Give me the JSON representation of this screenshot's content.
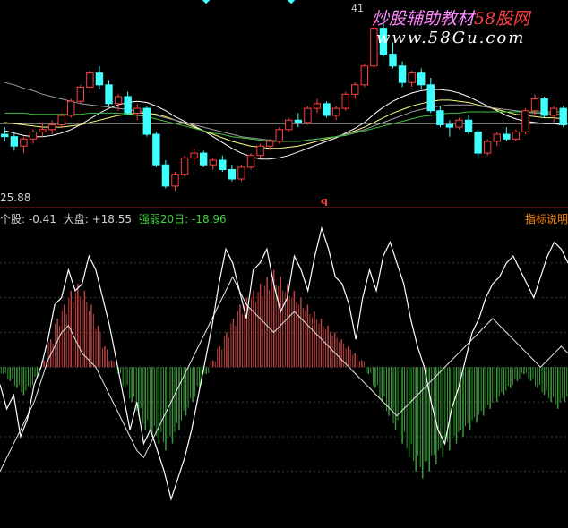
{
  "price_panel": {
    "low_label": "25.88",
    "high_label": "41",
    "marker_label": "q"
  },
  "indicator_header": {
    "stock_text": "个股: -0.41",
    "market_text": "大盘: +18.55",
    "strength_text": "强弱20日: -18.96",
    "help_button": "指标说明"
  },
  "watermark": {
    "cn_part1": "炒股辅助教材",
    "cn_part2": "58股网",
    "url": "www.58Gu.com"
  },
  "colors": {
    "up": "#ff4040",
    "down": "#40ffff",
    "hist_up": "#c04040",
    "hist_down": "#3a9a3a",
    "line_white": "#ffffff",
    "stock_green": "#40d040",
    "watermark": "#ff88ff"
  },
  "chart_data": [
    {
      "type": "candlestick",
      "title": "",
      "ylim": [
        25.5,
        42
      ],
      "ohlc": [
        [
          31.2,
          31.8,
          30.6,
          31.0
        ],
        [
          31.0,
          31.4,
          29.8,
          30.2
        ],
        [
          30.2,
          31.0,
          29.6,
          30.8
        ],
        [
          30.8,
          31.6,
          30.4,
          31.4
        ],
        [
          31.4,
          32.2,
          31.0,
          31.6
        ],
        [
          31.6,
          32.4,
          31.2,
          32.0
        ],
        [
          32.0,
          33.0,
          31.8,
          32.8
        ],
        [
          32.8,
          34.2,
          32.6,
          34.0
        ],
        [
          34.0,
          35.4,
          33.8,
          35.2
        ],
        [
          35.2,
          36.6,
          34.8,
          36.4
        ],
        [
          36.4,
          37.0,
          35.0,
          35.4
        ],
        [
          35.4,
          35.8,
          33.6,
          33.8
        ],
        [
          33.8,
          34.6,
          33.2,
          34.4
        ],
        [
          34.4,
          34.8,
          32.8,
          33.0
        ],
        [
          33.0,
          33.8,
          32.4,
          33.4
        ],
        [
          33.4,
          33.6,
          31.0,
          31.2
        ],
        [
          31.2,
          31.4,
          28.4,
          28.6
        ],
        [
          28.6,
          29.0,
          26.6,
          26.8
        ],
        [
          26.8,
          28.0,
          26.4,
          27.8
        ],
        [
          27.8,
          29.4,
          27.6,
          29.2
        ],
        [
          29.2,
          30.0,
          28.6,
          29.6
        ],
        [
          29.6,
          29.8,
          28.4,
          28.6
        ],
        [
          28.6,
          29.2,
          28.2,
          29.0
        ],
        [
          29.0,
          29.4,
          28.0,
          28.2
        ],
        [
          28.2,
          28.6,
          27.2,
          27.4
        ],
        [
          27.4,
          28.6,
          27.2,
          28.4
        ],
        [
          28.4,
          29.6,
          28.2,
          29.4
        ],
        [
          29.4,
          30.4,
          29.2,
          30.2
        ],
        [
          30.2,
          30.8,
          29.8,
          30.6
        ],
        [
          30.6,
          31.8,
          30.4,
          31.6
        ],
        [
          31.6,
          32.6,
          31.4,
          32.4
        ],
        [
          32.4,
          33.0,
          31.8,
          32.2
        ],
        [
          32.2,
          33.6,
          32.0,
          33.4
        ],
        [
          33.4,
          34.2,
          33.0,
          33.8
        ],
        [
          33.8,
          34.0,
          32.6,
          32.8
        ],
        [
          32.8,
          33.6,
          32.4,
          33.4
        ],
        [
          33.4,
          34.8,
          33.2,
          34.6
        ],
        [
          34.6,
          35.6,
          34.2,
          35.4
        ],
        [
          35.4,
          37.2,
          35.2,
          37.0
        ],
        [
          37.0,
          41.0,
          36.8,
          40.2
        ],
        [
          40.2,
          40.6,
          37.8,
          38.0
        ],
        [
          38.0,
          39.0,
          36.8,
          37.0
        ],
        [
          37.0,
          37.4,
          35.2,
          35.6
        ],
        [
          35.6,
          36.6,
          35.2,
          36.4
        ],
        [
          36.4,
          36.8,
          35.0,
          35.4
        ],
        [
          35.4,
          36.0,
          33.0,
          33.2
        ],
        [
          33.2,
          33.6,
          31.8,
          32.0
        ],
        [
          32.0,
          32.4,
          31.0,
          31.8
        ],
        [
          31.8,
          32.6,
          31.6,
          32.4
        ],
        [
          32.4,
          32.8,
          31.2,
          31.4
        ],
        [
          31.4,
          31.6,
          29.2,
          29.6
        ],
        [
          29.6,
          30.8,
          29.4,
          30.6
        ],
        [
          30.6,
          31.4,
          30.2,
          31.2
        ],
        [
          31.2,
          31.8,
          30.6,
          30.8
        ],
        [
          30.8,
          31.6,
          30.6,
          31.4
        ],
        [
          31.4,
          33.4,
          31.2,
          33.2
        ],
        [
          33.2,
          34.6,
          32.8,
          34.2
        ],
        [
          34.2,
          34.4,
          32.6,
          32.8
        ],
        [
          32.8,
          33.6,
          32.2,
          33.4
        ],
        [
          33.4,
          33.6,
          31.8,
          32.0
        ]
      ],
      "moving_averages": [
        {
          "values": [
            31.5,
            31.3,
            31.1,
            31.0,
            31.0,
            31.1,
            31.3,
            31.6,
            32.0,
            32.5,
            33.0,
            33.4,
            33.7,
            33.9,
            34.0,
            33.9,
            33.6,
            33.2,
            32.7,
            32.3,
            31.9,
            31.5,
            31.0,
            30.5,
            30.0,
            29.6,
            29.3,
            29.1,
            29.1,
            29.2,
            29.4,
            29.7,
            30.0,
            30.3,
            30.6,
            30.9,
            31.3,
            31.7,
            32.2,
            32.9,
            33.5,
            34.0,
            34.4,
            34.7,
            34.9,
            35.0,
            35.0,
            34.9,
            34.7,
            34.4,
            34.0,
            33.6,
            33.2,
            32.8,
            32.5,
            32.3,
            32.2,
            32.1,
            32.1,
            32.0
          ]
        },
        {
          "values": [
            32.2,
            32.1,
            32.0,
            31.9,
            31.8,
            31.8,
            31.8,
            31.9,
            32.0,
            32.2,
            32.4,
            32.6,
            32.8,
            32.9,
            33.0,
            33.0,
            32.9,
            32.7,
            32.4,
            32.1,
            31.8,
            31.5,
            31.2,
            30.9,
            30.6,
            30.4,
            30.2,
            30.1,
            30.0,
            30.0,
            30.1,
            30.2,
            30.4,
            30.6,
            30.8,
            31.0,
            31.2,
            31.5,
            31.8,
            32.2,
            32.6,
            33.0,
            33.3,
            33.6,
            33.8,
            34.0,
            34.1,
            34.1,
            34.0,
            33.9,
            33.7,
            33.5,
            33.3,
            33.1,
            32.9,
            32.8,
            32.7,
            32.6,
            32.6,
            32.5
          ]
        },
        {
          "values": [
            35.6,
            35.4,
            35.1,
            34.9,
            34.6,
            34.4,
            34.2,
            34.0,
            33.8,
            33.7,
            33.6,
            33.5,
            33.4,
            33.3,
            33.2,
            33.0,
            32.8,
            32.6,
            32.4,
            32.2,
            32.0,
            31.8,
            31.6,
            31.4,
            31.2,
            31.0,
            30.9,
            30.8,
            30.7,
            30.6,
            30.6,
            30.6,
            30.7,
            30.8,
            30.9,
            31.0,
            31.2,
            31.4,
            31.6,
            31.9,
            32.2,
            32.5,
            32.8,
            33.1,
            33.3,
            33.5,
            33.6,
            33.7,
            33.7,
            33.7,
            33.6,
            33.5,
            33.4,
            33.3,
            33.2,
            33.1,
            33.0,
            33.0,
            32.9,
            32.9
          ]
        },
        {
          "values": [
            33.0,
            33.0,
            33.0,
            32.9,
            32.9,
            32.9,
            32.9,
            32.9,
            32.9,
            33.0,
            33.0,
            33.0,
            33.0,
            32.9,
            32.8,
            32.7,
            32.5,
            32.3,
            32.1,
            31.9,
            31.7,
            31.5,
            31.3,
            31.2,
            31.0,
            30.9,
            30.8,
            30.7,
            30.6,
            30.6,
            30.6,
            30.6,
            30.7,
            30.8,
            30.9,
            31.0,
            31.1,
            31.3,
            31.5,
            31.7,
            31.9,
            32.1,
            32.3,
            32.5,
            32.7,
            32.8,
            32.9,
            33.0,
            33.0,
            33.1,
            33.1,
            33.1,
            33.1,
            33.1,
            33.1,
            33.1,
            33.1,
            33.1,
            33.1,
            33.1
          ]
        }
      ]
    },
    {
      "type": "line",
      "title": "",
      "ylim": [
        -45,
        40
      ],
      "series": [
        {
          "name": "个股",
          "values": [
            -5,
            -12,
            -8,
            -20,
            -15,
            -5,
            0,
            8,
            18,
            20,
            28,
            22,
            24,
            32,
            28,
            20,
            12,
            2,
            -8,
            -18,
            -10,
            -22,
            -18,
            -24,
            -30,
            -38,
            -32,
            -26,
            -18,
            -8,
            2,
            12,
            24,
            34,
            30,
            22,
            14,
            28,
            30,
            34,
            24,
            16,
            20,
            32,
            28,
            22,
            32,
            40,
            34,
            26,
            24,
            18,
            8,
            20,
            28,
            22,
            32,
            36,
            30,
            24,
            14,
            6,
            0,
            -10,
            -18,
            -22,
            -12,
            -6,
            2,
            10,
            14,
            20,
            24,
            26,
            30,
            32,
            28,
            24,
            20,
            26,
            32,
            36,
            34,
            30
          ]
        },
        {
          "name": "大盘",
          "values": [
            -30,
            -26,
            -22,
            -18,
            -14,
            -10,
            -4,
            2,
            6,
            10,
            12,
            8,
            4,
            2,
            0,
            -4,
            -8,
            -12,
            -16,
            -20,
            -24,
            -26,
            -22,
            -18,
            -14,
            -10,
            -6,
            -2,
            2,
            6,
            10,
            14,
            18,
            22,
            26,
            22,
            18,
            16,
            14,
            12,
            10,
            12,
            14,
            16,
            14,
            12,
            10,
            8,
            6,
            4,
            2,
            0,
            -2,
            -4,
            -6,
            -8,
            -10,
            -12,
            -14,
            -12,
            -10,
            -8,
            -6,
            -4,
            -2,
            0,
            2,
            4,
            6,
            8,
            10,
            12,
            14,
            12,
            10,
            8,
            6,
            4,
            2,
            0,
            2,
            4,
            6,
            4
          ]
        },
        {
          "name": "强弱20日",
          "values": [
            -2,
            -4,
            -6,
            -8,
            -6,
            -3,
            2,
            8,
            14,
            18,
            22,
            24,
            22,
            18,
            12,
            6,
            2,
            -2,
            -6,
            -10,
            -14,
            -18,
            -20,
            -22,
            -24,
            -22,
            -18,
            -14,
            -10,
            -6,
            -2,
            2,
            6,
            10,
            14,
            18,
            20,
            22,
            24,
            26,
            28,
            26,
            24,
            22,
            20,
            18,
            16,
            14,
            12,
            10,
            8,
            6,
            4,
            2,
            -2,
            -6,
            -10,
            -14,
            -18,
            -22,
            -26,
            -30,
            -32,
            -30,
            -28,
            -26,
            -24,
            -22,
            -20,
            -18,
            -16,
            -14,
            -12,
            -10,
            -8,
            -6,
            -4,
            -2,
            -4,
            -6,
            -8,
            -10,
            -12,
            -10
          ]
        }
      ]
    }
  ]
}
